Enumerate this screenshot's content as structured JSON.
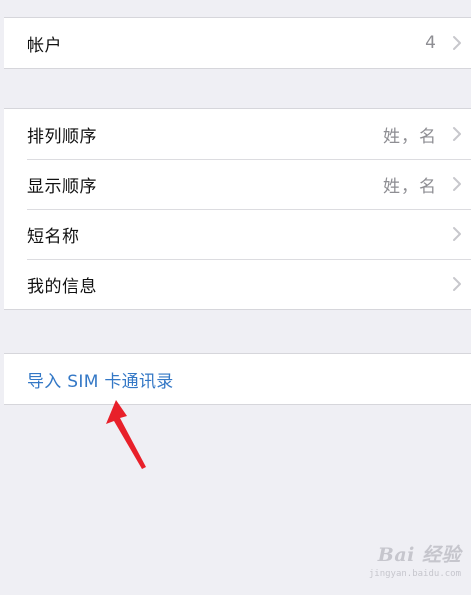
{
  "accounts_section": {
    "row": {
      "label": "帐户",
      "value": "4"
    }
  },
  "display_section": {
    "rows": [
      {
        "label": "排列顺序",
        "value": "姓，名"
      },
      {
        "label": "显示顺序",
        "value": "姓，名"
      },
      {
        "label": "短名称",
        "value": ""
      },
      {
        "label": "我的信息",
        "value": ""
      }
    ]
  },
  "import_section": {
    "label": "导入 SIM 卡通讯录"
  },
  "colors": {
    "background": "#efeff4",
    "link_blue": "#3478c6",
    "annotation_arrow": "#e8202a"
  },
  "watermark": {
    "main": "Bai 经验",
    "sub": "jingyan.baidu.com"
  }
}
